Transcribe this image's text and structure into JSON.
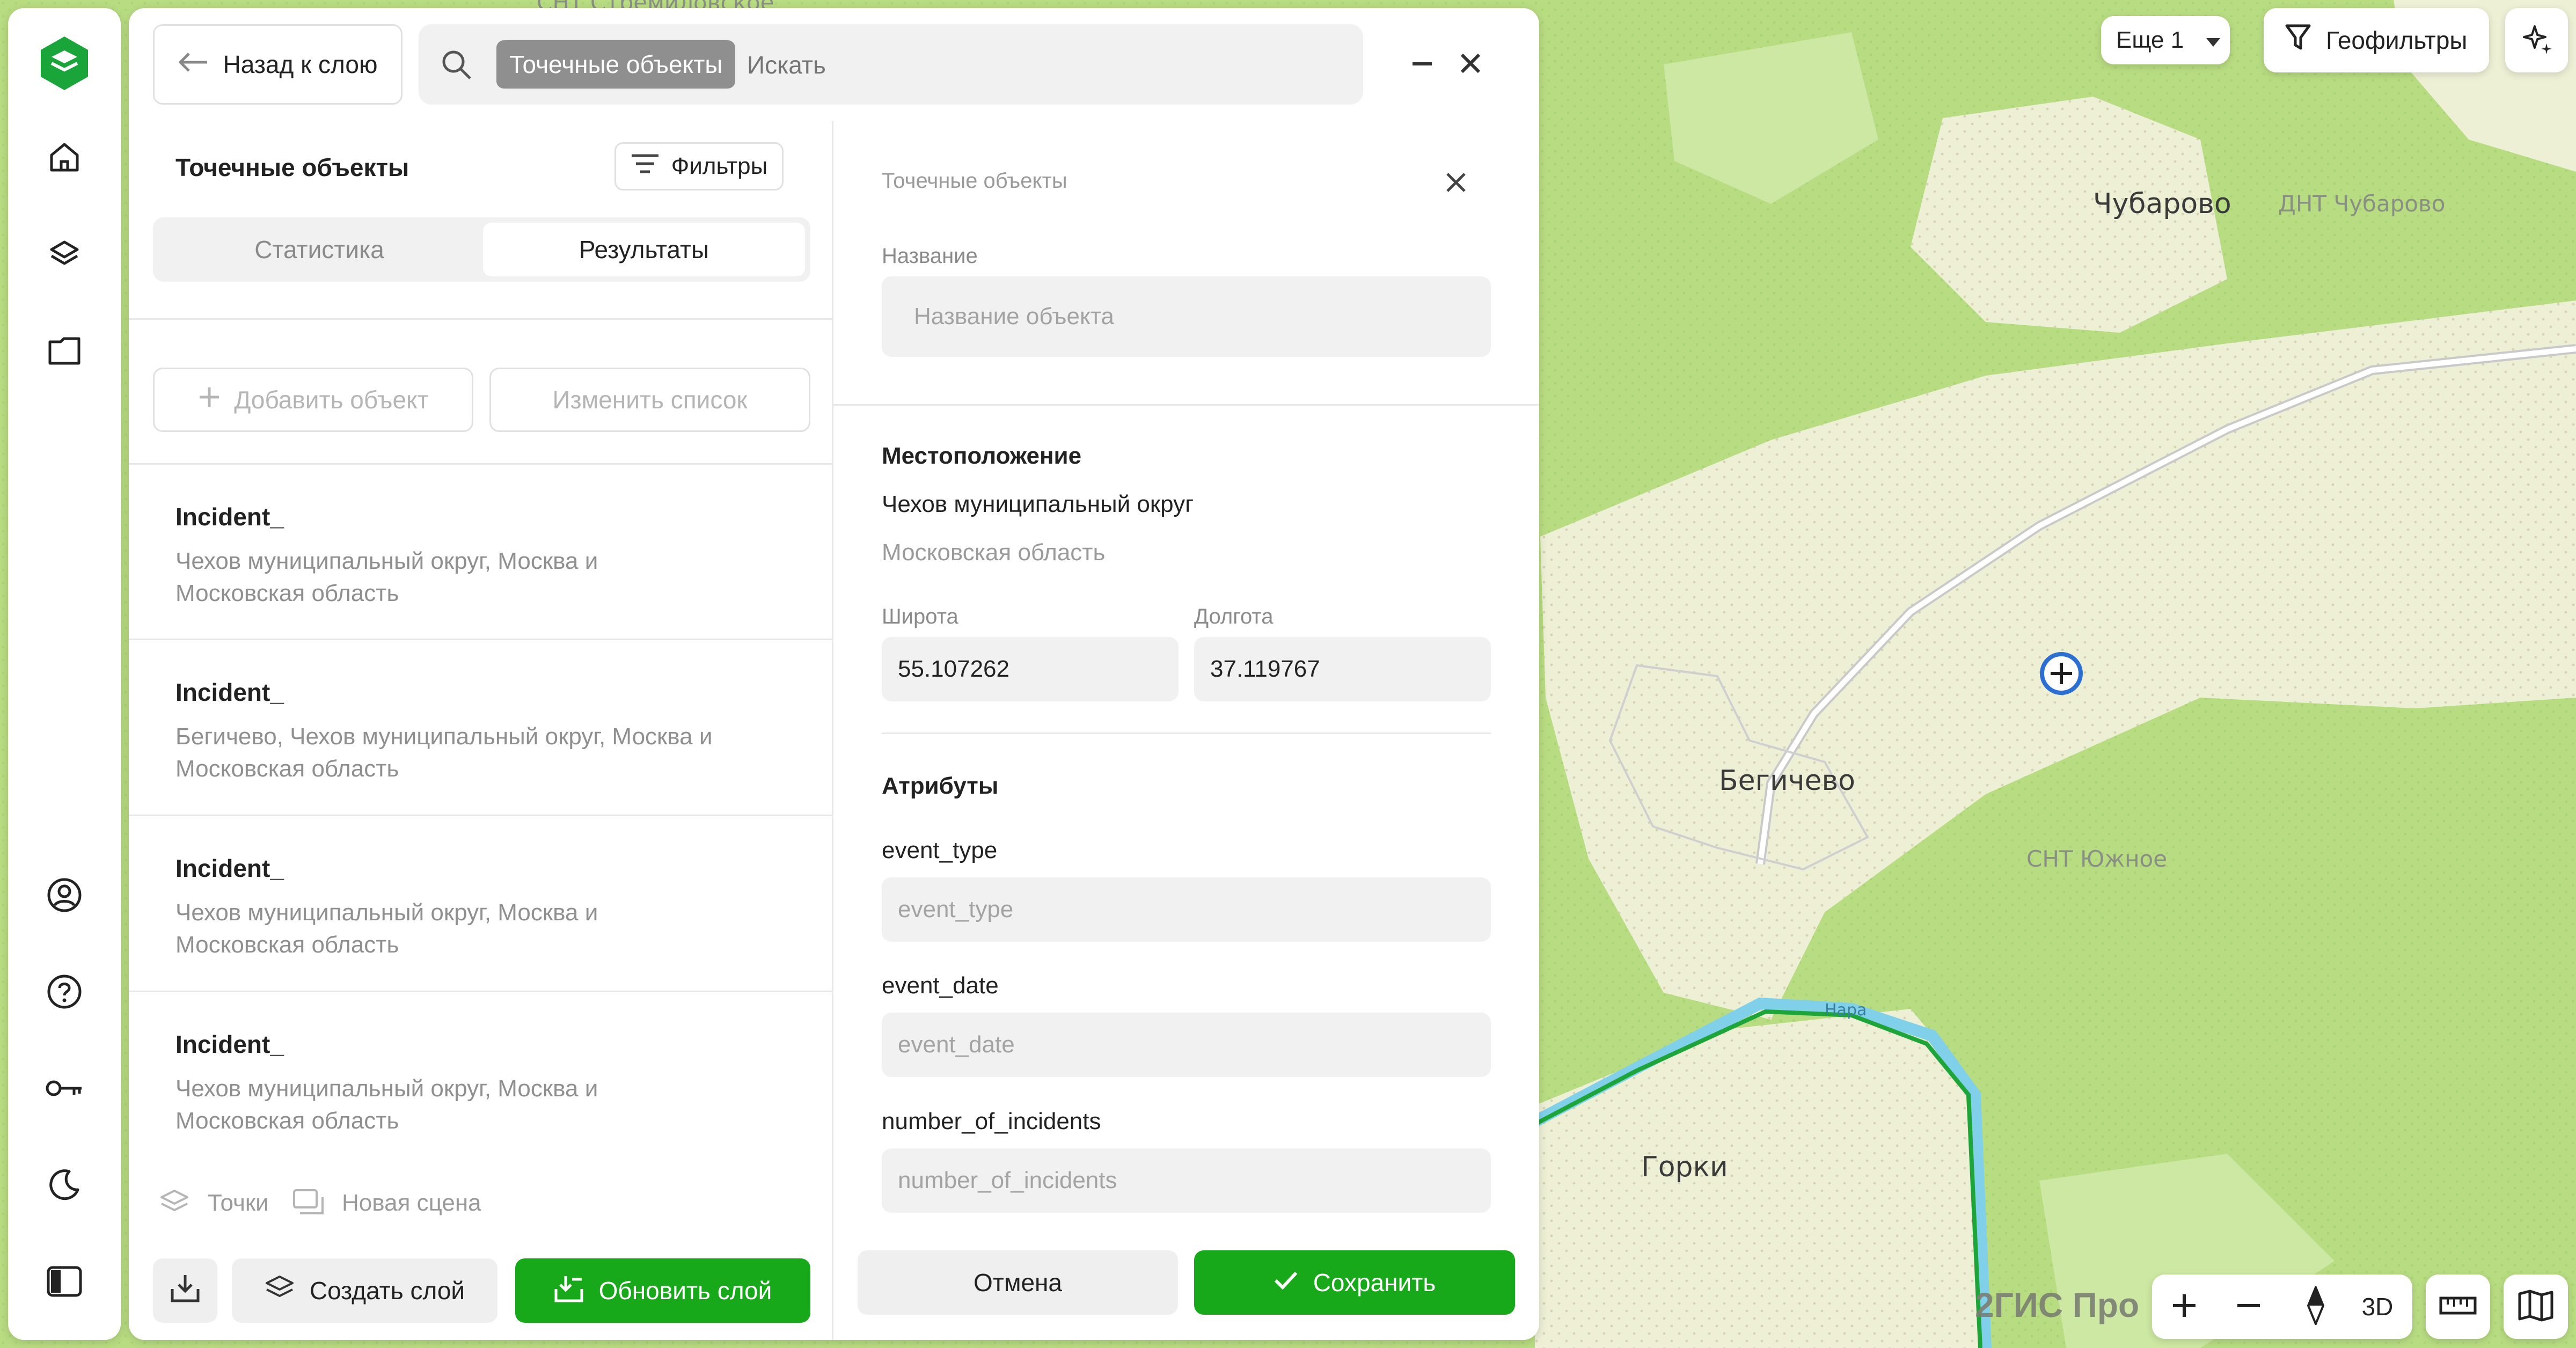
{
  "map": {
    "labels": {
      "chubarovo": "Чубарово",
      "dnt_chubarovo": "ДНТ Чубарово",
      "begichevo": "Бегичево",
      "snt_yuzhnoe": "СНТ Южное",
      "gorki": "Горки",
      "snt_top": "СНТ Стремиловское",
      "river": "Нара"
    },
    "more_label": "Еще 1",
    "geofilters_label": "Геофильтры",
    "brand": "2ГИС Про",
    "view_3d": "3D",
    "colors": {
      "forest": "#b5dc7e",
      "field": "#e9eccc",
      "river": "#7fd0e8",
      "route": "#1ea53a"
    }
  },
  "rail": {
    "items": [
      "logo-icon",
      "home-icon",
      "layers-icon",
      "folder-icon",
      "account-icon",
      "help-icon",
      "key-icon",
      "moon-icon",
      "panel-icon"
    ]
  },
  "header": {
    "back_label": "Назад к слою",
    "search_chip": "Точечные объекты",
    "search_placeholder": "Искать"
  },
  "left": {
    "title": "Точечные объекты",
    "filters_label": "Фильтры",
    "tabs": [
      "Статистика",
      "Результаты"
    ],
    "active_tab": "Результаты",
    "add_object": "Добавить объект",
    "edit_list": "Изменить список",
    "items": [
      {
        "title": "Incident_",
        "subtitle": "Чехов муниципальный округ, Москва и Московская область"
      },
      {
        "title": "Incident_",
        "subtitle": "Бегичево, Чехов муниципальный округ, Москва и Московская область"
      },
      {
        "title": "Incident_",
        "subtitle": "Чехов муниципальный округ, Москва и Московская область"
      },
      {
        "title": "Incident_",
        "subtitle": "Чехов муниципальный округ, Москва и Московская область"
      }
    ],
    "footer_points": "Точки",
    "footer_scene": "Новая сцена",
    "create_layer": "Создать слой",
    "update_layer": "Обновить слой"
  },
  "right": {
    "header": "Точечные объекты",
    "name_label": "Название",
    "name_placeholder": "Название объекта",
    "location_title": "Местоположение",
    "location_line1": "Чехов муниципальный округ",
    "location_line2": "Московская область",
    "lat_label": "Широта",
    "lat_value": "55.107262",
    "lon_label": "Долгота",
    "lon_value": "37.119767",
    "attributes_title": "Атрибуты",
    "attributes": [
      {
        "label": "event_type",
        "placeholder": "event_type"
      },
      {
        "label": "event_date",
        "placeholder": "event_date"
      },
      {
        "label": "number_of_incidents",
        "placeholder": "number_of_incidents"
      }
    ],
    "cancel": "Отмена",
    "save": "Сохранить"
  }
}
